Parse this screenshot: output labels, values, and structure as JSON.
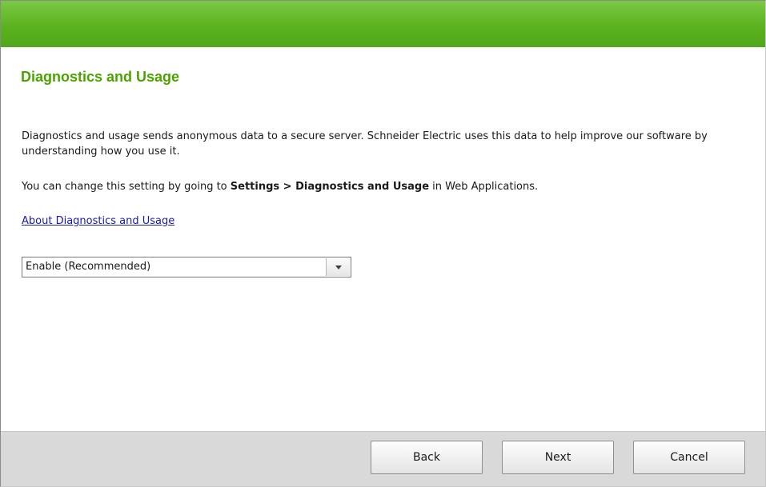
{
  "colors": {
    "header_green": "#5cb21f",
    "title_green": "#4ca300",
    "link_blue": "#1a1aa6",
    "footer_gray": "#d9d9d9"
  },
  "page": {
    "title": "Diagnostics and Usage",
    "description": "Diagnostics and usage sends anonymous data to a secure server. Schneider Electric uses this data to help improve our software by understanding how you use it.",
    "change_setting_prefix": "You can change this setting by going to ",
    "change_setting_path": "Settings > Diagnostics and Usage",
    "change_setting_suffix": " in Web Applications.",
    "about_link": "About Diagnostics and Usage"
  },
  "setting_dropdown": {
    "selected": "Enable (Recommended)",
    "icon": "chevron-down-icon"
  },
  "footer": {
    "back_label": "Back",
    "next_label": "Next",
    "cancel_label": "Cancel"
  }
}
